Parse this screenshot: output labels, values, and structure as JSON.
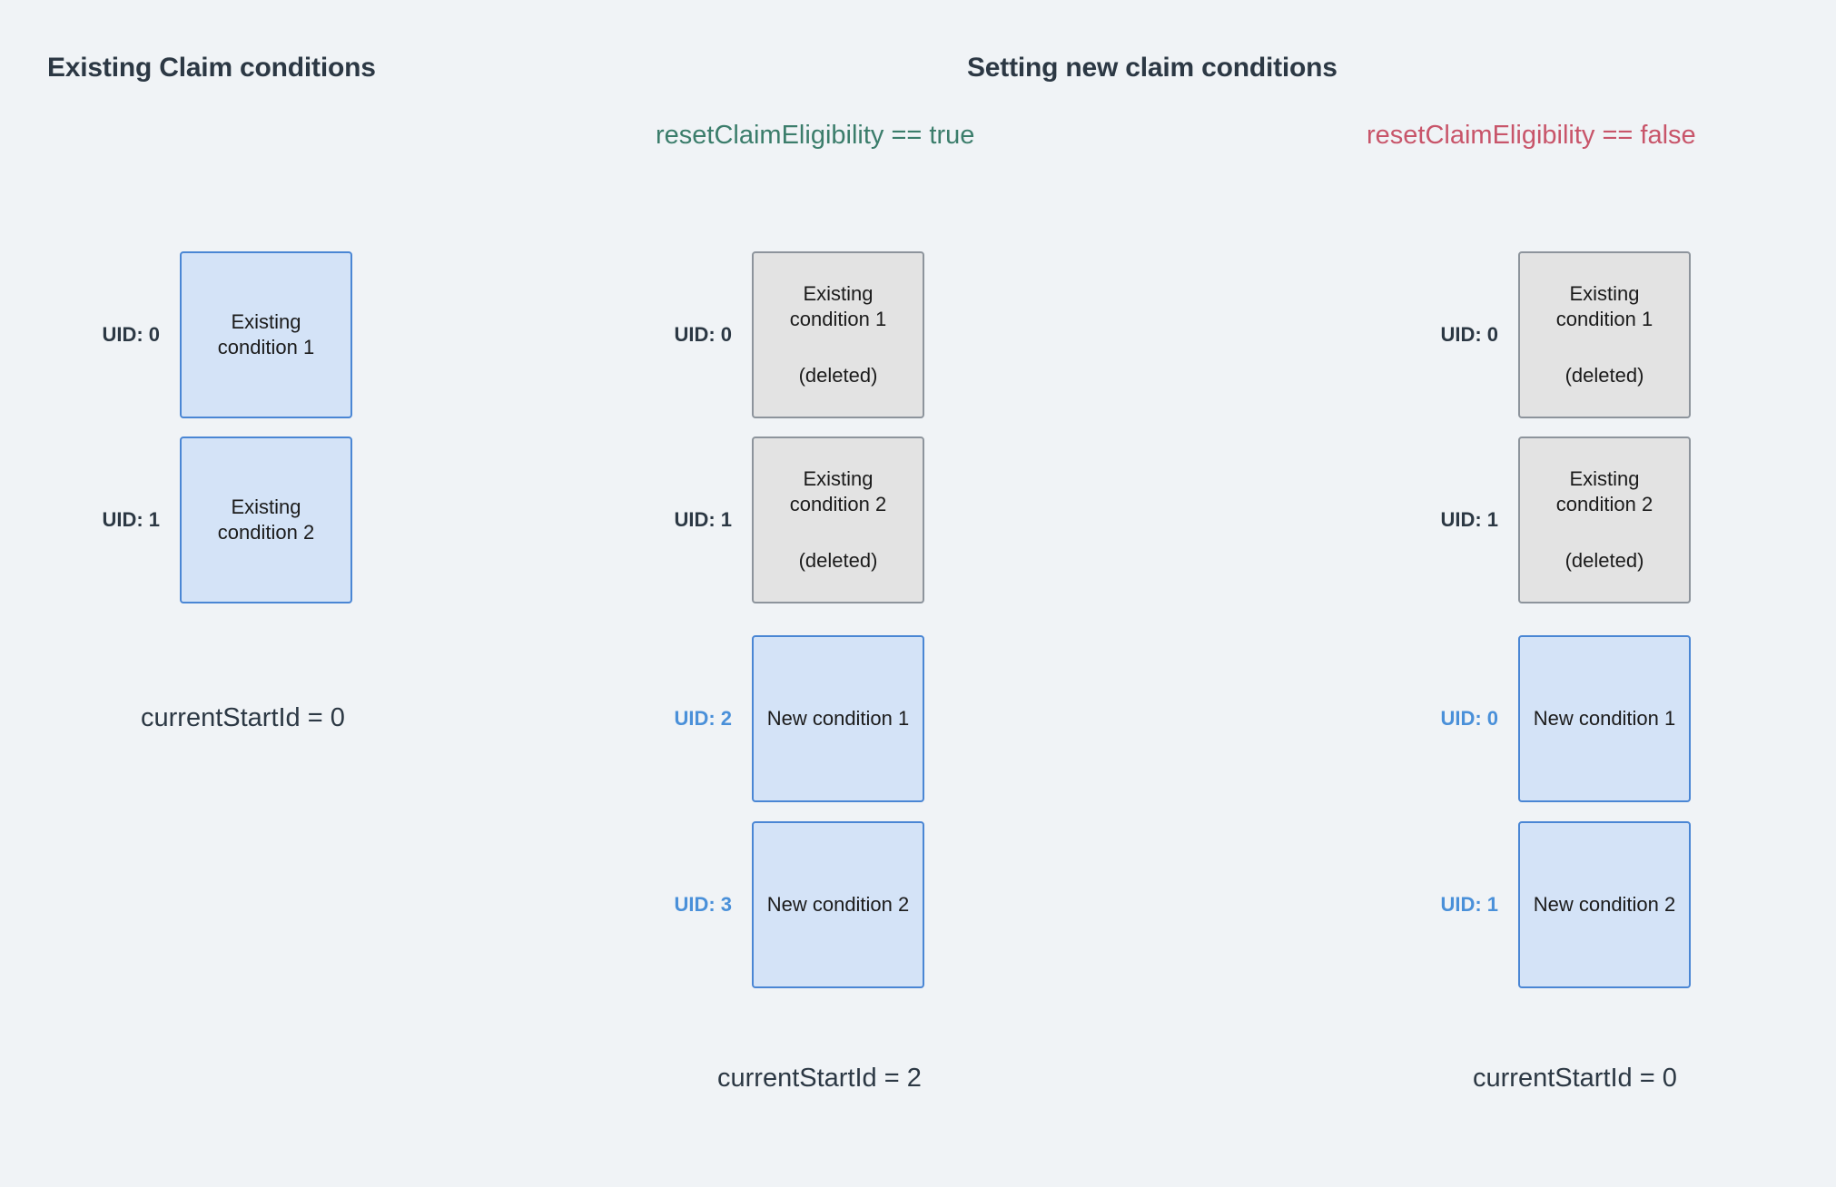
{
  "page": {
    "background_color": "#f0f3f6",
    "text_color": "#2c3844"
  },
  "headings": {
    "left": "Existing Claim conditions",
    "right": "Setting new claim conditions"
  },
  "conditions": {
    "true_label": "resetClaimEligibility == true",
    "true_color": "#3b7d6b",
    "false_label": "resetClaimEligibility == false",
    "false_color": "#c8556a"
  },
  "colors": {
    "existing_box_fill": "#d4e3f7",
    "existing_box_border": "#4a86d4",
    "deleted_box_fill": "#e3e3e3",
    "deleted_box_border": "#8d949c",
    "new_uid_color": "#4a90d9",
    "uid_color": "#2c3844"
  },
  "columns": {
    "existing": {
      "rows": [
        {
          "uid": "UID: 0",
          "uid_style": "default",
          "title": "Existing condition 1",
          "sub": "",
          "style": "existing"
        },
        {
          "uid": "UID: 1",
          "uid_style": "default",
          "title": "Existing condition 2",
          "sub": "",
          "style": "existing"
        }
      ],
      "start_id": "currentStartId = 0"
    },
    "reset_true": {
      "rows": [
        {
          "uid": "UID: 0",
          "uid_style": "default",
          "title": "Existing condition 1",
          "sub": "(deleted)",
          "style": "deleted"
        },
        {
          "uid": "UID: 1",
          "uid_style": "default",
          "title": "Existing condition 2",
          "sub": "(deleted)",
          "style": "deleted"
        },
        {
          "uid": "UID: 2",
          "uid_style": "new",
          "title": "New condition 1",
          "sub": "",
          "style": "new"
        },
        {
          "uid": "UID: 3",
          "uid_style": "new",
          "title": "New condition 2",
          "sub": "",
          "style": "new"
        }
      ],
      "start_id": "currentStartId = 2"
    },
    "reset_false": {
      "rows": [
        {
          "uid": "UID: 0",
          "uid_style": "default",
          "title": "Existing condition 1",
          "sub": "(deleted)",
          "style": "deleted"
        },
        {
          "uid": "UID: 1",
          "uid_style": "default",
          "title": "Existing condition 2",
          "sub": "(deleted)",
          "style": "deleted"
        },
        {
          "uid": "UID: 0",
          "uid_style": "new",
          "title": "New condition 1",
          "sub": "",
          "style": "new"
        },
        {
          "uid": "UID: 1",
          "uid_style": "new",
          "title": "New condition 2",
          "sub": "",
          "style": "new"
        }
      ],
      "start_id": "currentStartId = 0"
    }
  }
}
